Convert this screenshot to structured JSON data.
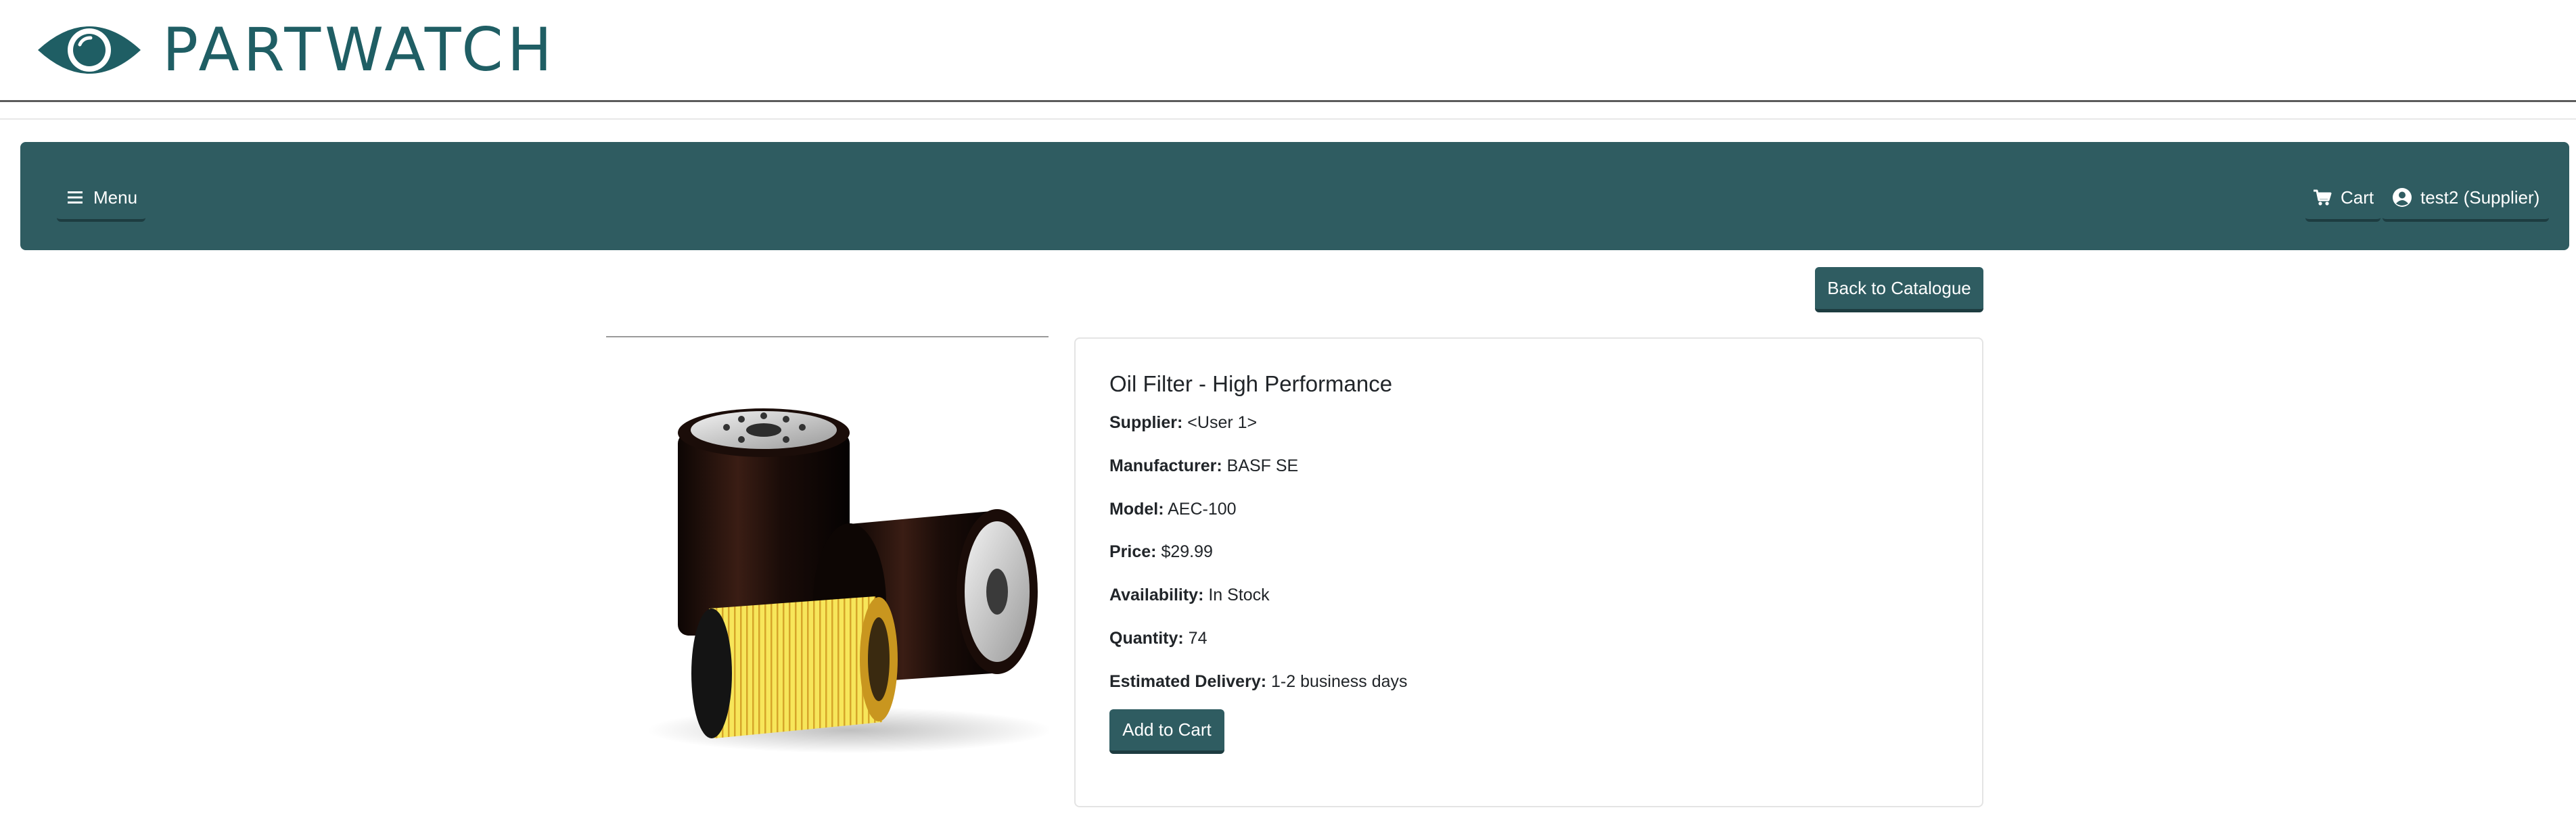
{
  "brand": {
    "name": "PARTWATCH",
    "icon": "eye-icon",
    "color": "#1f5e64"
  },
  "nav": {
    "menu_label": "Menu",
    "menu_icon": "hamburger-icon",
    "cart_label": "Cart",
    "cart_icon": "cart-icon",
    "user_label": "test2 (Supplier)",
    "user_icon": "user-circle-icon",
    "bar_color": "#2f5c61"
  },
  "actions": {
    "back_label": "Back to Catalogue",
    "add_to_cart_label": "Add to Cart"
  },
  "product": {
    "image_alt": "oil-filters-image",
    "title": "Oil Filter - High Performance",
    "fields": [
      {
        "key": "Supplier:",
        "value": "<User 1>"
      },
      {
        "key": "Manufacturer:",
        "value": "BASF SE"
      },
      {
        "key": "Model:",
        "value": "AEC-100"
      },
      {
        "key": "Price:",
        "value": "$29.99"
      },
      {
        "key": "Availability:",
        "value": "In Stock"
      },
      {
        "key": "Quantity:",
        "value": "74"
      },
      {
        "key": "Estimated Delivery:",
        "value": "1-2 business days"
      }
    ]
  }
}
